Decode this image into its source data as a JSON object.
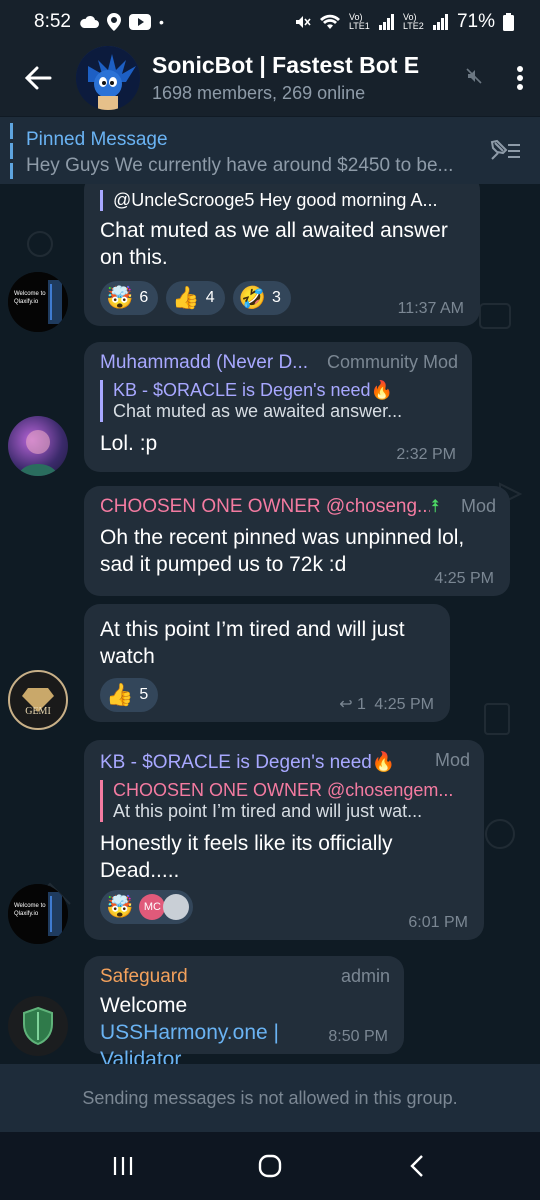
{
  "status": {
    "time": "8:52",
    "battery": "71%",
    "carrier1": "Vo) LTE1",
    "carrier2": "Vo) LTE2"
  },
  "header": {
    "title": "SonicBot | Fastest Bot E",
    "subtitle": "1698 members, 269 online"
  },
  "pinned": {
    "title": "Pinned Message",
    "text": "Hey Guys  We currently have around $2450 to be..."
  },
  "messages": [
    {
      "reply_text": "@UncleScrooge5 Hey good morning A...",
      "body": "Chat muted as we all awaited answer on this.",
      "reactions": [
        {
          "emoji": "🤯",
          "count": "6"
        },
        {
          "emoji": "👍",
          "count": "4"
        },
        {
          "emoji": "🤣",
          "count": "3"
        }
      ],
      "time": "11:37 AM"
    },
    {
      "sender": "Muhammadd (Never D...",
      "role": "Community Mod",
      "reply_name": "KB - $ORACLE is Degen's need🔥",
      "reply_text": "Chat muted as we awaited answer...",
      "body": "Lol. :p",
      "time": "2:32 PM"
    },
    {
      "sender": "CHOOSEN ONE OWNER @choseng...",
      "role": "Mod",
      "body": "Oh the recent pinned was unpinned lol, sad it pumped us to 72k :d",
      "time": "4:25 PM"
    },
    {
      "body": "At this point I’m tired and will just watch",
      "reactions": [
        {
          "emoji": "👍",
          "count": "5"
        }
      ],
      "reply_count": "1",
      "time": "4:25 PM"
    },
    {
      "sender": "KB - $ORACLE is Degen's need🔥",
      "role": "Mod",
      "reply_name": "CHOOSEN ONE OWNER @chosengem...",
      "reply_text": "At this point I’m tired and will just wat...",
      "body": "Honestly it feels like its officially Dead.....",
      "reactions": [
        {
          "emoji": "🤯",
          "count": "MC"
        }
      ],
      "time": "6:01 PM"
    },
    {
      "sender": "Safeguard",
      "role": "admin",
      "body_prefix": "Welcome ",
      "body_link": "USSHarmony.one | Validator",
      "time": "8:50 PM"
    }
  ],
  "avatars": {
    "a1": "Welcome to Qlaxify.io",
    "gem": "GEMI"
  },
  "footer": {
    "text": "Sending messages is not allowed in this group."
  },
  "colors": {
    "bg": "#0f1b24",
    "bubble": "#222e3a",
    "header": "#17212b",
    "accent": "#6ab3f3",
    "mod_pink": "#f47ba1",
    "purple": "#a8a8ff",
    "orange": "#f3a15c"
  }
}
